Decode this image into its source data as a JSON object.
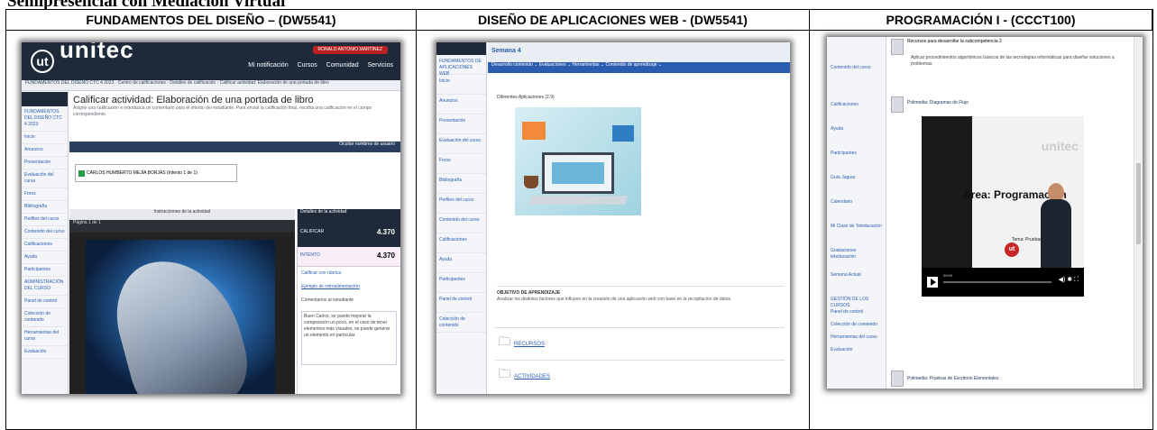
{
  "heading": "Semipresencial con Mediación Virtual",
  "columns": [
    {
      "header": "FUNDAMENTOS DEL DISEÑO – (DW5541)"
    },
    {
      "header": "DISEÑO DE APLICACIONES WEB - (DW5541)"
    },
    {
      "header": "PROGRAMACIÓN I - (CCCT100)"
    }
  ],
  "shot1": {
    "logo_mark": "ut",
    "logo_text": "unitec",
    "user_pill": "RONALD ANTONIO MARTÍNEZ",
    "nav": [
      "Mi notificación",
      "Cursos",
      "Comunidad",
      "Servicios"
    ],
    "breadcrumb": "FUNDAMENTOS DEL DISEÑO CTC 4 2023 · Centro de calificaciones · Detalles de calificación · Calificar actividad: Elaboración de una portada de libro",
    "sidebar": [
      "FUNDAMENTOS DEL DISEÑO CTC 4 2023",
      "Inicio",
      "Anuncios",
      "Presentación",
      "Evaluación del curso",
      "Foros",
      "Bibliografía",
      "Perfiles del curso",
      "Contenido del curso",
      "Calificaciones",
      "Ayuda",
      "Participantes",
      "ADMINISTRACIÓN DEL CURSO",
      "Panel de control",
      "Colección de contenido",
      "Herramientas del curso",
      "Evaluación"
    ],
    "title": "Calificar actividad: Elaboración de una portada de libro",
    "description": "Asigne una calificación e introduzca un comentario para el intento del estudiante. Para enviar la calificación final, escriba una calificación en el campo correspondiente.",
    "tabstrip": "Ocultar nombres de usuario",
    "student": "CARLOS HUMBERTO MEJÍA BORJAS (Intento 1 de 1)",
    "viewer_head": "Instrucciones de la actividad",
    "viewer_tools": "Página  1  de 1",
    "panel_head": "Detalles de la actividad",
    "calificar": "CALIFICAR",
    "score1": "4.370",
    "intento": "INTENTO",
    "score2": "4.370",
    "rubric_link": "Calificar con rúbrica",
    "rubric_link2": "Ejemplo de retroalimentación",
    "feedback_label": "Comentarios al estudiante",
    "feedback_text": "Buen Carlos, se puede mejorar la composición un poco, en el caso de tener elementos más visuales, se puede generar un elemento en particular."
  },
  "shot2": {
    "sidebar": [
      "FUNDAMENTOS DE APLICACIONES WEB",
      "Inicio",
      "Anuncios",
      "Presentación",
      "Evaluación del curso",
      "Foros",
      "Bibliografía",
      "Perfiles del curso",
      "Contenido del curso",
      "Calificaciones",
      "Ayuda",
      "Participantes",
      "Panel de control",
      "Colección de contenido"
    ],
    "week": "Semana 4",
    "menu": "Desarrollo contenido ⌄   Evaluaciones ⌄   Herramientas ⌄   Contenido de aprendizaje ⌄",
    "item": "Diferentes Aplicaciones (2.9)",
    "objective_title": "OBJETIVO DE APRENDIZAJE",
    "objective_text": "Analizar los distintos factores que influyen en la creación de una aplicación web con base en la recopilación de datos.",
    "folder1": "RECURSOS",
    "folder2": "ACTIVIDADES"
  },
  "shot3": {
    "sidebar": [
      "Contenido del curso",
      "Calificaciones",
      "Ayuda",
      "Participantes",
      "Guía Jaguar",
      "Calendario",
      "Mi Clase de Teleducación",
      "Grabaciones teleducación",
      "Semana Actual",
      "GESTIÓN DE LOS CURSOS",
      "Panel de control",
      "Colección de contenido",
      "Herramientas del curso",
      "Evaluación"
    ],
    "resources": "Recursos para desarrollar la subcompetencia 2",
    "resources_sub": "Aplicar procedimientos algorítmicos básicos de las tecnologías informáticas para diseñar soluciones a problemas.",
    "video_label": "Polimedia: Diagramas de Flujo",
    "video_title": "Área: Programación",
    "video_sub": "Tema: Pruebas de Escritorio",
    "watermark": "unitec",
    "badge": "ut",
    "time": "00:00",
    "next_label": "Polimedia: Pruebas de Escritorio Elementales"
  }
}
